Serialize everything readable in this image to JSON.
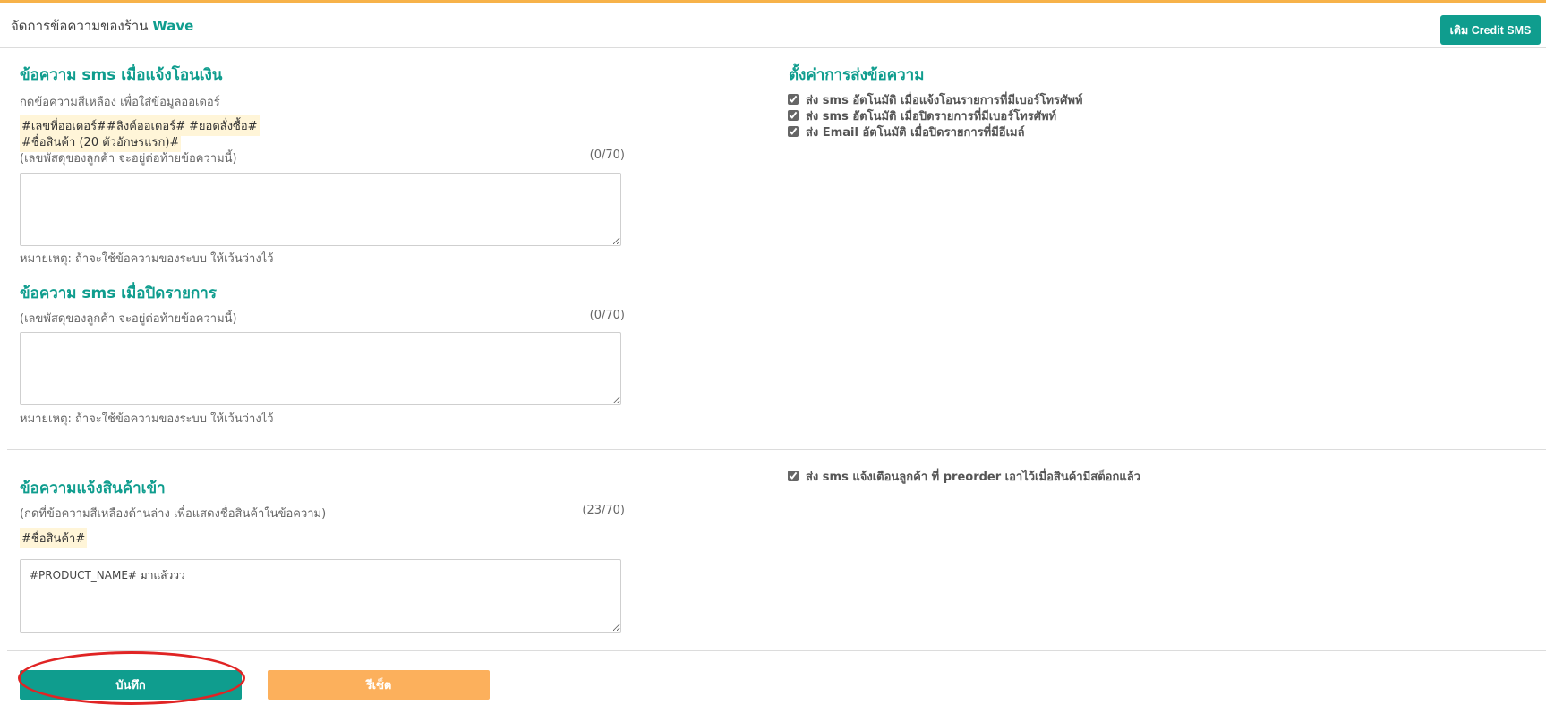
{
  "header": {
    "title_prefix": "จัดการข้อความของร้าน",
    "shop_name": "Wave",
    "credit_button": "เติม Credit SMS"
  },
  "transfer_sms": {
    "title": "ข้อความ sms เมื่อแจ้งโอนเงิน",
    "hint": "กดข้อความสีเหลือง เพื่อใส่ข้อมูลออเดอร์",
    "tags": [
      "#เลขที่ออเดอร์#",
      "#ลิงค์ออเดอร์#",
      "#ยอดสั่งซื้อ#",
      "#ชื่อสินค้า (20 ตัวอักษรแรก)#"
    ],
    "tracking_hint": "(เลขพัสดุของลูกค้า จะอยู่ต่อท้ายข้อความนี้)",
    "counter": "(0/70)",
    "value": "",
    "note": "หมายเหตุ: ถ้าจะใช้ข้อความของระบบ ให้เว้นว่างไว้"
  },
  "close_sms": {
    "title": "ข้อความ sms เมื่อปิดรายการ",
    "tracking_hint": "(เลขพัสดุของลูกค้า จะอยู่ต่อท้ายข้อความนี้)",
    "counter": "(0/70)",
    "value": "",
    "note": "หมายเหตุ: ถ้าจะใช้ข้อความของระบบ ให้เว้นว่างไว้"
  },
  "settings": {
    "title": "ตั้งค่าการส่งข้อความ",
    "options": [
      {
        "label": "ส่ง sms อัตโนมัติ เมื่อแจ้งโอนรายการที่มีเบอร์โทรศัพท์",
        "checked": true
      },
      {
        "label": "ส่ง sms อัตโนมัติ เมื่อปิดรายการที่มีเบอร์โทรศัพท์",
        "checked": true
      },
      {
        "label": "ส่ง Email อัตโนมัติ เมื่อปิดรายการที่มีอีเมล์",
        "checked": true
      }
    ]
  },
  "restock": {
    "title": "ข้อความแจ้งสินค้าเข้า",
    "hint": "(กดที่ข้อความสีเหลืองด้านล่าง เพื่อแสดงชื่อสินค้าในข้อความ)",
    "counter": "(23/70)",
    "tag": "#ชื่อสินค้า#",
    "value": "#PRODUCT_NAME# มาแล้ววว",
    "option_label": "ส่ง sms แจ้งเตือนลูกค้า ที่ preorder เอาไว้เมื่อสินค้ามีสต็อกแล้ว",
    "option_checked": true
  },
  "actions": {
    "save": "บันทึก",
    "reset": "รีเซ็ต"
  },
  "colors": {
    "accent": "#0f9d8e",
    "reset": "#fcb05c",
    "tag_bg": "#fff5d8",
    "top_bar": "#f7b249",
    "annotation": "#e02424"
  }
}
